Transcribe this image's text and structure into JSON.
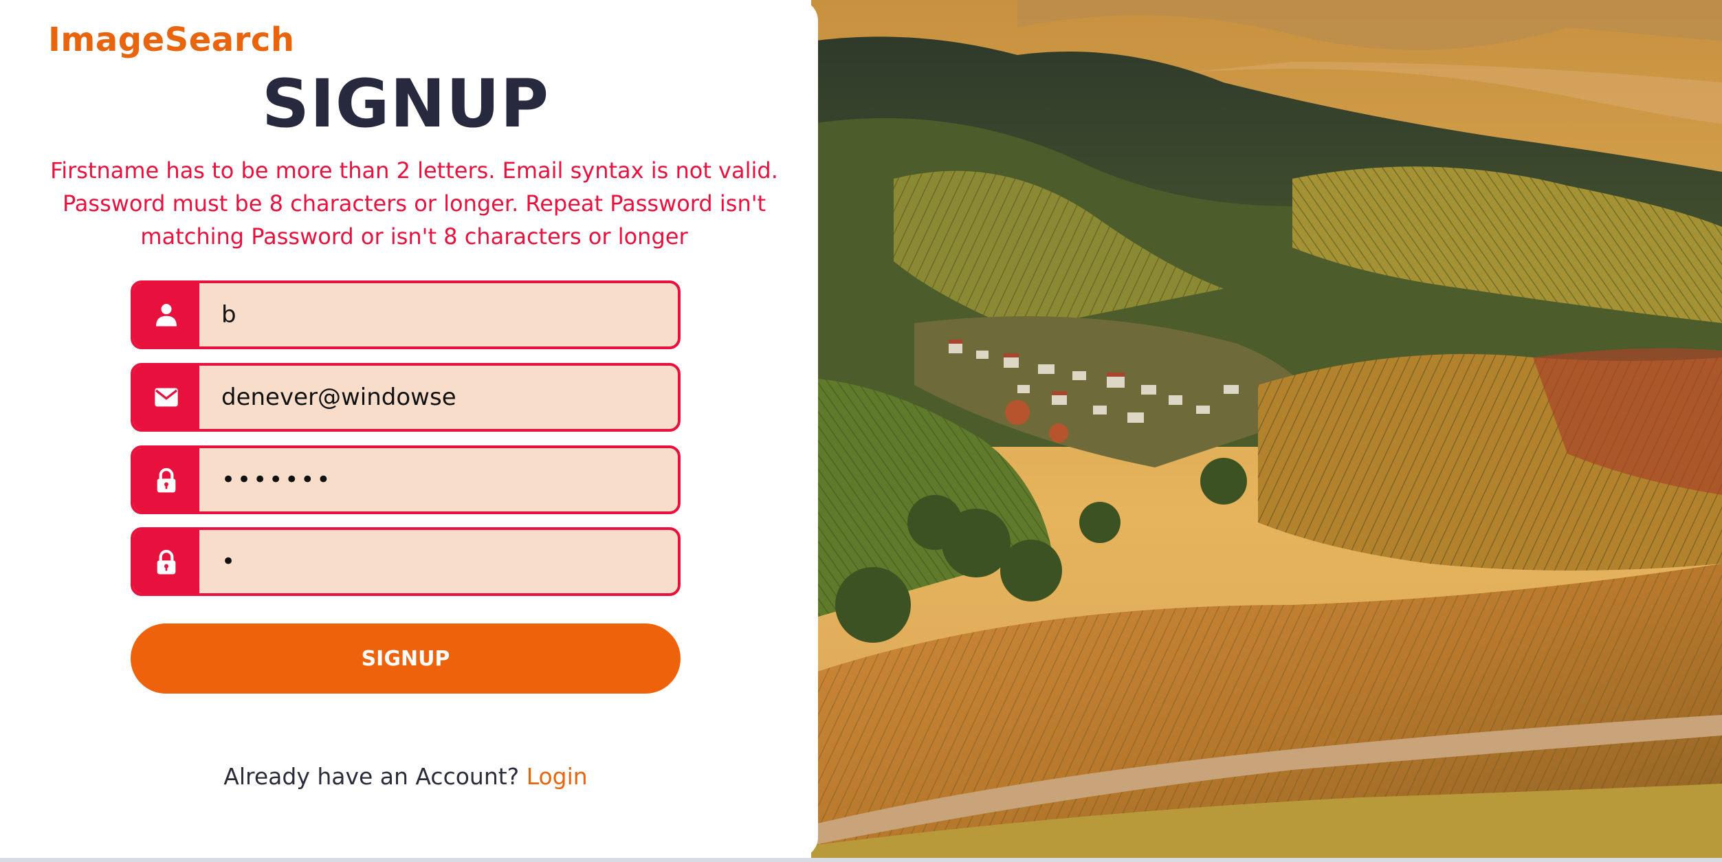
{
  "brand": {
    "name": "ImageSearch",
    "color": "#e8650e"
  },
  "form": {
    "title": "SIGNUP",
    "error_message": "Firstname has to be more than 2 letters. Email syntax is not valid. Password must be 8 characters or longer. Repeat Password isn't matching Password or isn't 8 characters or longer",
    "fields": [
      {
        "icon": "user-icon",
        "value": "b"
      },
      {
        "icon": "mail-icon",
        "value": "denever@windowse"
      },
      {
        "icon": "lock-icon",
        "value": "•••••••"
      },
      {
        "icon": "lock-icon",
        "value": "•"
      }
    ],
    "submit_label": "SIGNUP",
    "footer_text": "Already have an Account?",
    "login_link": "Login"
  },
  "colors": {
    "error": "#e8113e",
    "field_bg": "#f8ddcb",
    "button": "#ee620c",
    "title": "#272a3f"
  },
  "scenery": {
    "description_icon": "vineyard-landscape-image"
  }
}
